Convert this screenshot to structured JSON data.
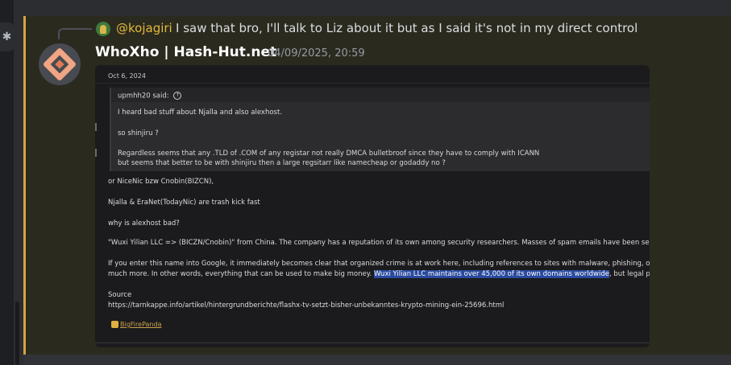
{
  "reply": {
    "author": "@kojagiri",
    "text": "I saw that bro, I'll talk to Liz about it but as I said it's not in my direct control"
  },
  "message": {
    "username": "WhoXho | Hash-Hut.net",
    "timestamp": "04/09/2025, 20:59"
  },
  "screenshot": {
    "date": "Oct 6, 2024",
    "quote_author": "upmhh20 said:",
    "quote_lines": [
      "I heard bad stuff about Njalla and also alexhost.",
      "so shinjiru ?",
      "Regardless seems that any .TLD of .COM of any registar not really DMCA bulletbroof since they have to comply with ICANN",
      "but seems that better to be with shinjiru then a large regsitarr like namecheap or godaddy no ?"
    ],
    "post_lines": [
      "or NiceNic bzw Cnobin(BIZCN),",
      "Njalla & EraNet(TodayNic) are trash kick fast",
      "why is alexhost bad?",
      "\"Wuxi Yilian LLC => (BICZN/Cnobin)\" from China. The company has a reputation of its own among security researchers. Masses of spam emails have been sent from",
      "If you enter this name into Google, it immediately becomes clear that organized crime is at work here, including references to sites with malware, phishing, online sto",
      "Source",
      "https://tarnkappe.info/artikel/hintergrundberichte/flashx-tv-setzt-bisher-unbekanntes-krypto-mining-ein-25696.html"
    ],
    "line_hl_pre": "much more. In other words, everything that can be used to make big money. ",
    "line_hl": "Wuxi Yilian LLC maintains over 45,000 of its own domains worldwide",
    "line_hl_post": ", but legal purpos",
    "reaction_user": "BigFirePanda"
  },
  "icons": {
    "gear": "gear-icon",
    "reply_avatar": "user-avatar",
    "avatar": "diamond-logo"
  },
  "colors": {
    "mention_highlight": "#d6a540",
    "reply_author": "#e2b93b",
    "selection": "#2a4a9e"
  }
}
